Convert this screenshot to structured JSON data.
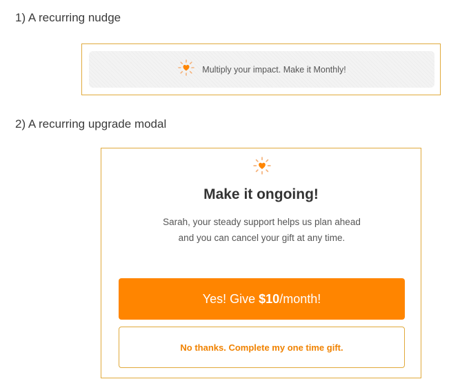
{
  "headings": {
    "nudge": "1) A recurring nudge",
    "modal": "2) A recurring upgrade modal"
  },
  "nudge": {
    "icon": "heart-sparkle-icon",
    "text": "Multiply your impact. Make it Monthly!"
  },
  "modal": {
    "icon": "heart-sparkle-icon",
    "title": "Make it ongoing!",
    "body_line1": "Sarah, your steady support helps us plan ahead",
    "body_line2": "and you can cancel your gift at any time.",
    "primary_prefix": "Yes! Give ",
    "primary_amount": "$10",
    "primary_suffix": "/month!",
    "secondary_label": "No thanks. Complete my one time gift."
  },
  "colors": {
    "accent": "#ff8500",
    "frame": "#e0a93a"
  }
}
